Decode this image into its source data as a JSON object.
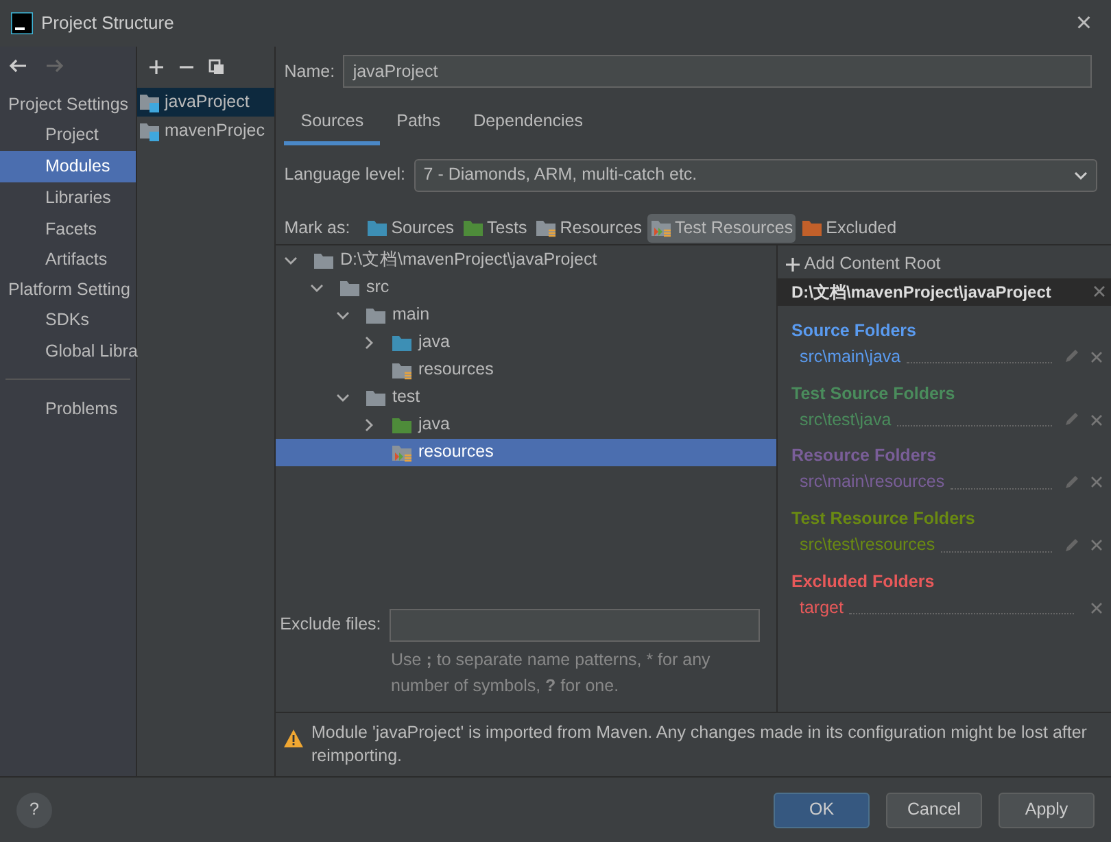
{
  "window": {
    "title": "Project Structure",
    "close": "×"
  },
  "sidebar": {
    "groups": [
      {
        "heading": "Project Settings",
        "items": [
          {
            "label": "Project",
            "selected": false
          },
          {
            "label": "Modules",
            "selected": true
          },
          {
            "label": "Libraries",
            "selected": false
          },
          {
            "label": "Facets",
            "selected": false
          },
          {
            "label": "Artifacts",
            "selected": false
          }
        ]
      },
      {
        "heading": "Platform Setting",
        "items": [
          {
            "label": "SDKs",
            "selected": false
          },
          {
            "label": "Global Libra",
            "selected": false
          }
        ]
      },
      {
        "items": [
          {
            "label": "Problems",
            "selected": false
          }
        ]
      }
    ]
  },
  "modules": [
    {
      "label": "javaProject",
      "selected": true
    },
    {
      "label": "mavenProjec",
      "selected": false
    }
  ],
  "name_field": {
    "label": "Name:",
    "value": "javaProject"
  },
  "tabs": [
    {
      "label": "Sources",
      "selected": true
    },
    {
      "label": "Paths",
      "selected": false
    },
    {
      "label": "Dependencies",
      "selected": false
    }
  ],
  "language_level": {
    "label": "Language level:",
    "value": "7 - Diamonds, ARM, multi-catch etc."
  },
  "mark_as": {
    "label": "Mark as:",
    "buttons": [
      {
        "label": "Sources",
        "kind": "sources",
        "selected": false
      },
      {
        "label": "Tests",
        "kind": "tests",
        "selected": false
      },
      {
        "label": "Resources",
        "kind": "resources",
        "selected": false
      },
      {
        "label": "Test Resources",
        "kind": "test_resources",
        "selected": true
      },
      {
        "label": "Excluded",
        "kind": "excluded",
        "selected": false
      }
    ]
  },
  "tree": [
    {
      "label": "D:\\文档\\mavenProject\\javaProject",
      "kind": "plain",
      "expanded": true,
      "selected": false,
      "children": [
        {
          "label": "src",
          "kind": "plain",
          "expanded": true,
          "selected": false,
          "children": [
            {
              "label": "main",
              "kind": "plain",
              "expanded": true,
              "selected": false,
              "children": [
                {
                  "label": "java",
                  "kind": "sources",
                  "expanded": false,
                  "selected": false
                },
                {
                  "label": "resources",
                  "kind": "resources",
                  "selected": false
                }
              ]
            },
            {
              "label": "test",
              "kind": "plain",
              "expanded": true,
              "selected": false,
              "children": [
                {
                  "label": "java",
                  "kind": "tests",
                  "expanded": false,
                  "selected": false
                },
                {
                  "label": "resources",
                  "kind": "test_resources",
                  "selected": true
                }
              ]
            }
          ]
        }
      ]
    }
  ],
  "content_roots": {
    "add_label": "Add Content Root",
    "root_path": "D:\\文档\\mavenProject\\javaProject",
    "groups": [
      {
        "title": "Source Folders",
        "color": "#5a9bf0",
        "items": [
          {
            "path": "src\\main\\java",
            "editable": true
          }
        ]
      },
      {
        "title": "Test Source Folders",
        "color": "#4a8c5c",
        "items": [
          {
            "path": "src\\test\\java",
            "editable": true
          }
        ]
      },
      {
        "title": "Resource Folders",
        "color": "#7a5e99",
        "items": [
          {
            "path": "src\\main\\resources",
            "editable": true
          }
        ]
      },
      {
        "title": "Test Resource Folders",
        "color": "#6a8a12",
        "items": [
          {
            "path": "src\\test\\resources",
            "editable": true
          }
        ]
      },
      {
        "title": "Excluded Folders",
        "color": "#e8595a",
        "items": [
          {
            "path": "target",
            "editable": false
          }
        ]
      }
    ]
  },
  "exclude_files": {
    "label": "Exclude files:",
    "hint": "Use **;** to separate name patterns, * for any number of symbols, **?** for one."
  },
  "warning": "Module 'javaProject' is imported from Maven. Any changes made in its configuration might be lost after reimporting.",
  "footer": {
    "help": "?",
    "buttons": [
      {
        "label": "OK",
        "kind": "primary"
      },
      {
        "label": "Cancel",
        "kind": "secondary"
      },
      {
        "label": "Apply",
        "kind": "secondary"
      }
    ]
  }
}
